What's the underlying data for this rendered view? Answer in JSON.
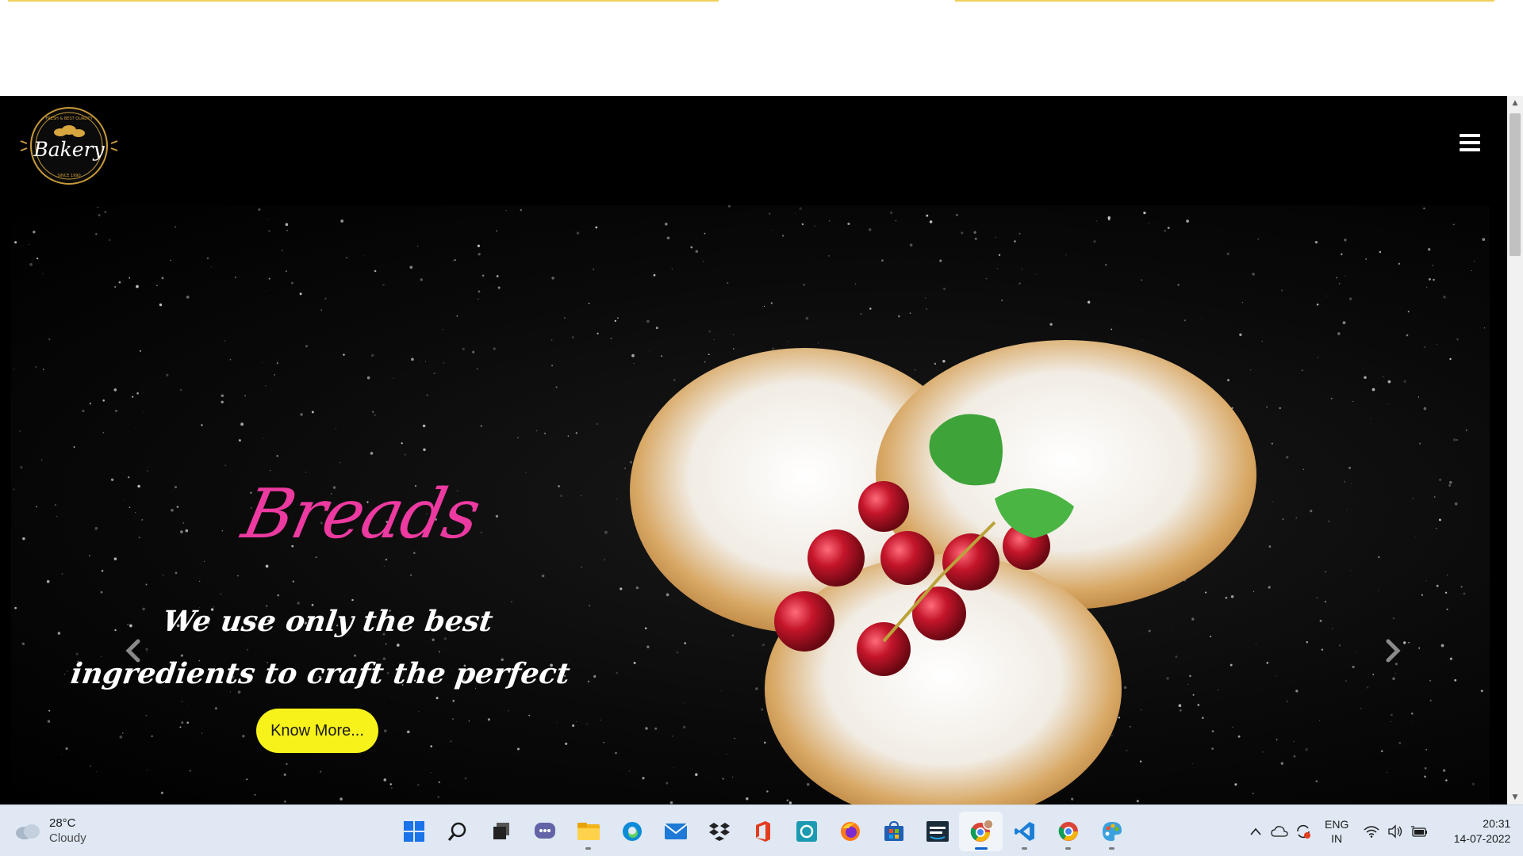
{
  "site": {
    "logo": {
      "top_text": "FRESH & BEST QUALITY",
      "name": "Bakery",
      "bottom_text": "SINCE 1990"
    }
  },
  "hero": {
    "title": "Breads",
    "subtitle": "We use only the best ingredients to craft the perfect loaf.",
    "cta_label": "Know More..."
  },
  "colors": {
    "title": "#ec3aa0",
    "cta_bg": "#f7f21a",
    "gold": "#f2cf5a"
  },
  "taskbar": {
    "weather": {
      "temp": "28°C",
      "condition": "Cloudy"
    },
    "apps": [
      "windows-start",
      "search",
      "task-view",
      "chat",
      "file-explorer",
      "edge",
      "mail",
      "dropbox",
      "office",
      "alexa",
      "firefox",
      "microsoft-store",
      "prime-video",
      "chrome-profile",
      "vscode",
      "chrome",
      "paint"
    ],
    "active_app": "chrome-profile",
    "language": {
      "line1": "ENG",
      "line2": "IN"
    },
    "clock": {
      "time": "20:31",
      "date": "14-07-2022"
    }
  }
}
